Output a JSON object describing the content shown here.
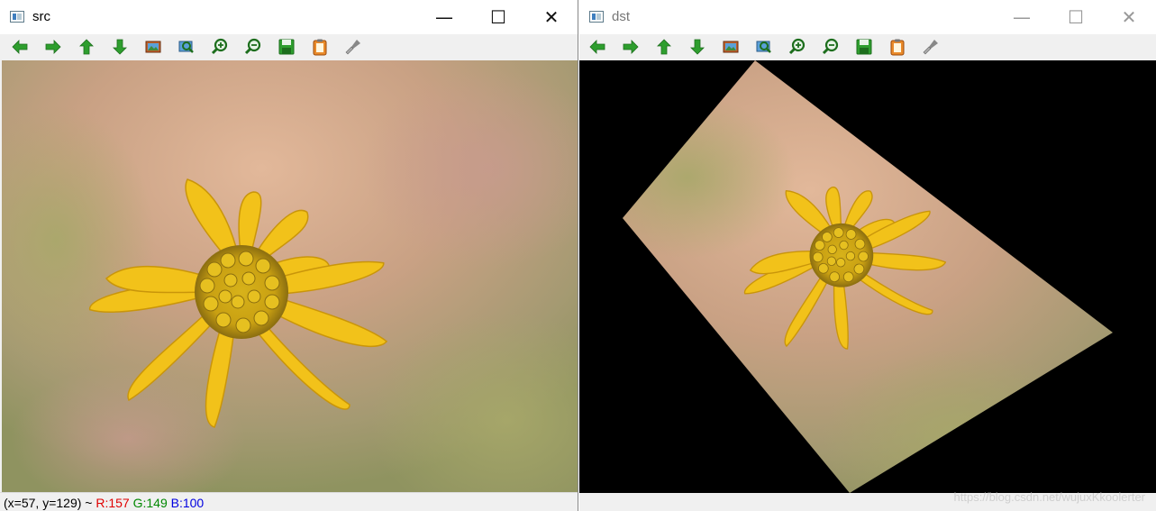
{
  "src_window": {
    "title": "src",
    "status": {
      "coords": "(x=57, y=129) ~ ",
      "r": "R:157",
      "g": "G:149",
      "b": "B:100"
    }
  },
  "dst_window": {
    "title": "dst"
  },
  "caption_buttons": {
    "minimize": "—",
    "maximize": "☐",
    "close": "✕"
  },
  "toolbar_icons": [
    "pan-left-icon",
    "pan-right-icon",
    "pan-up-icon",
    "pan-down-icon",
    "zoom-fit-icon",
    "zoom-region-icon",
    "zoom-in-icon",
    "zoom-out-icon",
    "save-icon",
    "copy-clipboard-icon",
    "properties-icon"
  ],
  "watermark": "https://blog.csdn.net/wujuxKkoolerter",
  "colors": {
    "toolbar_arrow": "#2e9e2e",
    "petal": "#f2c21a",
    "background_blur": "#c8a98a"
  }
}
